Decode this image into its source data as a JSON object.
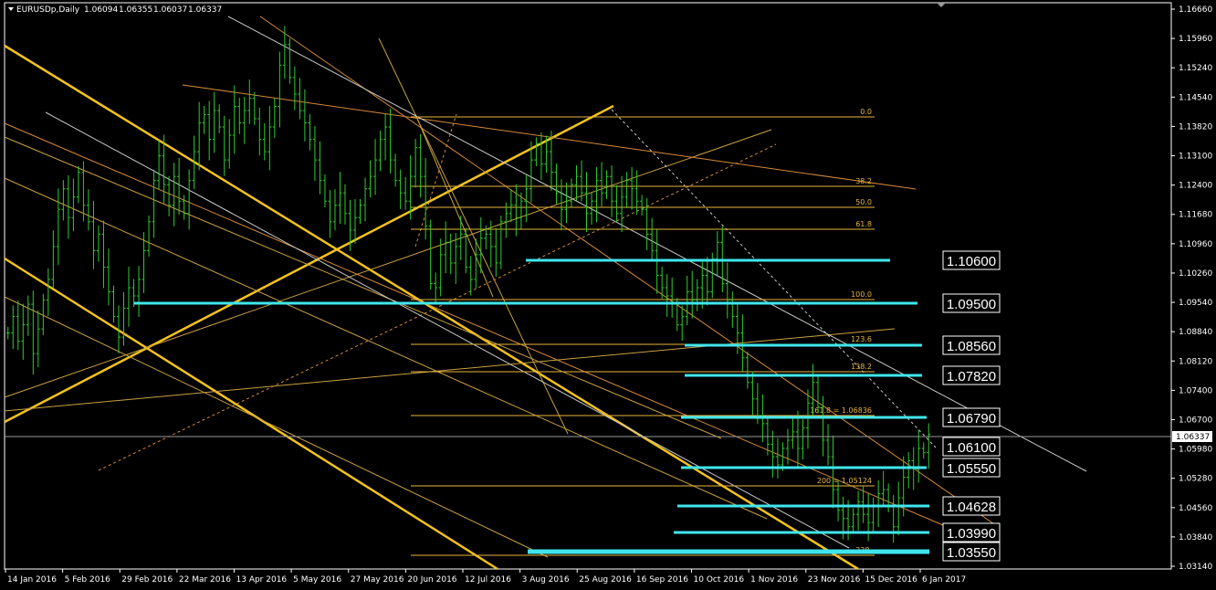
{
  "header": {
    "symbol": "EURUSDp,Daily",
    "open": "1.06094",
    "high": "1.06355",
    "low": "1.06037",
    "close": "1.06337"
  },
  "colors": {
    "background": "#000000",
    "candle": "#2ecc2e",
    "level": "#3fe6ee",
    "fib": "#e8b53c",
    "trend_yellow": "#f2c21c",
    "trend_orange": "#d4893a",
    "trend_white": "#c8c8c8"
  },
  "chart_data": {
    "type": "candlestick",
    "symbol": "EURUSDp",
    "timeframe": "Daily",
    "ylim": [
      1.0314,
      1.1666
    ],
    "x_tick_labels": [
      "14 Jan 2016",
      "5 Feb 2016",
      "29 Feb 2016",
      "22 Mar 2016",
      "13 Apr 2016",
      "5 May 2016",
      "27 May 2016",
      "20 Jun 2016",
      "12 Jul 2016",
      "3 Aug 2016",
      "25 Aug 2016",
      "16 Sep 2016",
      "10 Oct 2016",
      "1 Nov 2016",
      "23 Nov 2016",
      "15 Dec 2016",
      "6 Jan 2017"
    ],
    "y_tick_labels": [
      "1.16660",
      "1.15960",
      "1.15240",
      "1.14540",
      "1.13820",
      "1.13100",
      "1.12400",
      "1.11680",
      "1.10960",
      "1.10260",
      "1.09540",
      "1.08840",
      "1.08120",
      "1.07400",
      "1.06700",
      "1.05980",
      "1.05280",
      "1.04560",
      "1.03840",
      "1.03140"
    ],
    "current_price": "1.06337",
    "support_resistance_levels": [
      "1.10600",
      "1.09500",
      "1.08560",
      "1.07820",
      "1.06790",
      "1.06100",
      "1.05550",
      "1.04628",
      "1.03990",
      "1.03550"
    ],
    "fib_labels": [
      "0.0",
      "38.2",
      "50.0",
      "61.8",
      "100.0",
      "123.6",
      "138.2",
      "161.8 = 1.06836",
      "200 = 1.05124",
      "238."
    ],
    "closes": [
      1.088,
      1.092,
      1.086,
      1.09,
      1.095,
      1.083,
      1.089,
      1.096,
      1.101,
      1.109,
      1.118,
      1.123,
      1.116,
      1.121,
      1.127,
      1.119,
      1.115,
      1.108,
      1.112,
      1.104,
      1.098,
      1.092,
      1.087,
      1.094,
      1.099,
      1.097,
      1.101,
      1.108,
      1.115,
      1.125,
      1.131,
      1.124,
      1.119,
      1.126,
      1.12,
      1.117,
      1.125,
      1.132,
      1.139,
      1.141,
      1.135,
      1.142,
      1.138,
      1.13,
      1.136,
      1.143,
      1.139,
      1.142,
      1.145,
      1.14,
      1.135,
      1.132,
      1.138,
      1.143,
      1.153,
      1.158,
      1.15,
      1.146,
      1.142,
      1.139,
      1.135,
      1.13,
      1.125,
      1.12,
      1.115,
      1.119,
      1.122,
      1.117,
      1.113,
      1.116,
      1.119,
      1.123,
      1.126,
      1.13,
      1.135,
      1.138,
      1.13,
      1.125,
      1.122,
      1.12,
      1.126,
      1.133,
      1.126,
      1.114,
      1.1,
      1.099,
      1.107,
      1.11,
      1.105,
      1.109,
      1.112,
      1.104,
      1.101,
      1.107,
      1.111,
      1.112,
      1.109,
      1.105,
      1.115,
      1.117,
      1.119,
      1.116,
      1.12,
      1.123,
      1.13,
      1.134,
      1.129,
      1.132,
      1.127,
      1.122,
      1.118,
      1.12,
      1.124,
      1.126,
      1.122,
      1.117,
      1.12,
      1.125,
      1.122,
      1.126,
      1.12,
      1.117,
      1.121,
      1.125,
      1.123,
      1.12,
      1.118,
      1.112,
      1.108,
      1.102,
      1.099,
      1.097,
      1.095,
      1.09,
      1.092,
      1.098,
      1.096,
      1.099,
      1.102,
      1.098,
      1.106,
      1.11,
      1.1,
      1.096,
      1.092,
      1.088,
      1.082,
      1.076,
      1.072,
      1.068,
      1.066,
      1.061,
      1.058,
      1.056,
      1.06,
      1.062,
      1.064,
      1.06,
      1.065,
      1.071,
      1.076,
      1.07,
      1.062,
      1.058,
      1.05,
      1.045,
      1.043,
      1.041,
      1.044,
      1.047,
      1.044,
      1.042,
      1.046,
      1.049,
      1.05,
      1.046,
      1.041,
      1.048,
      1.053,
      1.057,
      1.055,
      1.06,
      1.059,
      1.0634
    ]
  }
}
